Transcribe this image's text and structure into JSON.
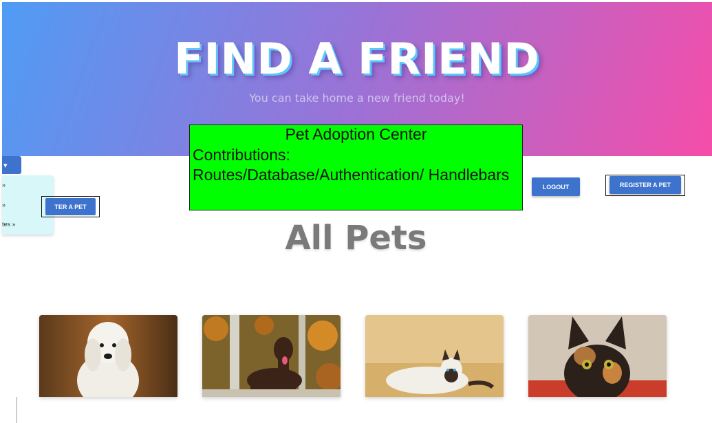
{
  "hero": {
    "title": "FIND A FRIEND",
    "subtitle": "You can take home a new friend today!"
  },
  "banner": {
    "title": "Pet Adoption Center",
    "line1": "Contributions:",
    "line2": "Routes/Database/Authentication/ Handlebars",
    "color": "#00ff00"
  },
  "nav": {
    "dropdown_toggle": "▾",
    "dropdown_items": [
      "»",
      "»",
      "tes »"
    ],
    "register_left_label": "TER A PET",
    "logout_label": "LOGOUT",
    "register_label": "REGISTER A PET",
    "accent": "#3d73cc"
  },
  "main": {
    "heading": "All Pets",
    "pets": [
      {
        "kind": "white dog"
      },
      {
        "kind": "brown dog"
      },
      {
        "kind": "siamese cat"
      },
      {
        "kind": "tortoiseshell cat"
      }
    ]
  }
}
